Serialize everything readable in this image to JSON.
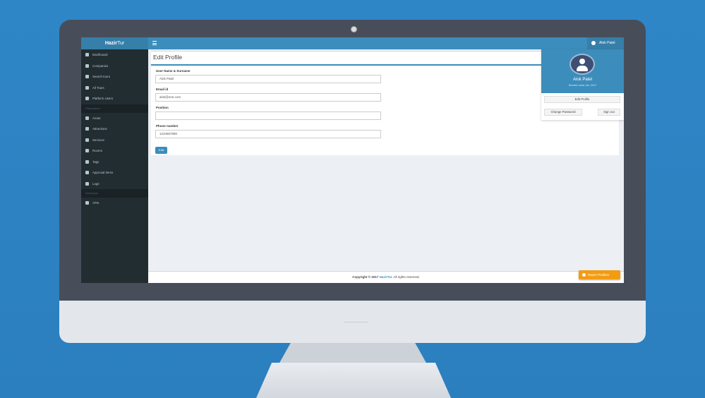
{
  "app": {
    "logo_bold": "Hazir",
    "logo_light": "Tur",
    "user_name": "Alok Patel"
  },
  "sidebar": {
    "items": [
      {
        "label": "Dashboard",
        "icon": "dashboard-icon"
      },
      {
        "label": "Companies",
        "icon": "building-icon"
      },
      {
        "label": "Search tours",
        "icon": "bus-icon"
      },
      {
        "label": "All Tours",
        "icon": "bus-icon"
      },
      {
        "label": "Platform Users",
        "icon": "user-icon"
      }
    ],
    "section1_header": "Parameters",
    "items2": [
      {
        "label": "Areas",
        "icon": "flag-icon"
      },
      {
        "label": "Attractions",
        "icon": "image-icon"
      },
      {
        "label": "Services",
        "icon": "check-square-icon"
      },
      {
        "label": "Rooms",
        "icon": "bed-icon"
      },
      {
        "label": "Tags",
        "icon": "tags-icon"
      },
      {
        "label": "Approval Items",
        "icon": "list-icon"
      },
      {
        "label": "Logs",
        "icon": "history-icon"
      }
    ],
    "section2_header": "Developer",
    "items3": [
      {
        "label": "APIs",
        "icon": "key-icon"
      }
    ]
  },
  "form": {
    "title": "Edit Profile",
    "fields": [
      {
        "label": "User Name & Surname",
        "value": "Alok Patel"
      },
      {
        "label": "Email id",
        "value": "alok@one.com"
      },
      {
        "label": "Position",
        "value": ""
      },
      {
        "label": "Phone number",
        "value": "1234567890"
      }
    ],
    "submit_label": "Edit"
  },
  "dropdown": {
    "name": "Alok Patel",
    "member_since": "Member since Jun, 2017",
    "edit_profile_label": "Edit Profile",
    "change_password_label": "Change Password",
    "sign_out_label": "Sign out"
  },
  "footer": {
    "prefix": "Copyright © 2017",
    "brand": "HazirTur.",
    "suffix": "All rights reserved."
  },
  "report_button": {
    "label": "Report Problem"
  },
  "colors": {
    "primary": "#3c8dbc",
    "sidebar": "#222d32",
    "warning": "#f39c12",
    "background": "#2f86c6"
  }
}
